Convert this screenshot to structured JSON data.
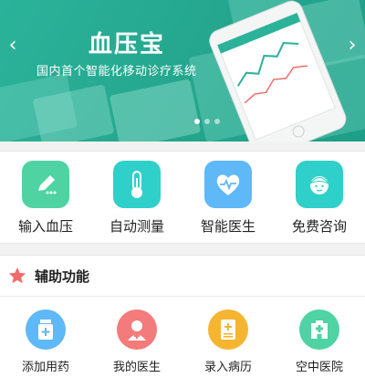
{
  "banner": {
    "title": "血压宝",
    "subtitle": "国内首个智能化移动诊疗系统",
    "prev_icon": "chevron-left-icon",
    "next_icon": "chevron-right-icon",
    "slide_count": 3,
    "active_slide": 1
  },
  "quick_actions": [
    {
      "label": "输入血压",
      "icon": "pencil-icon",
      "color": "#4fd3a3"
    },
    {
      "label": "自动测量",
      "icon": "thermometer-icon",
      "color": "#2fd0c9"
    },
    {
      "label": "智能医生",
      "icon": "heartbeat-icon",
      "color": "#5fb8f7"
    },
    {
      "label": "免费咨询",
      "icon": "nurse-icon",
      "color": "#2fd0c9"
    }
  ],
  "section": {
    "title": "辅助功能",
    "icon": "star-icon",
    "icon_color": "#f26b6b"
  },
  "tools": [
    {
      "label": "添加用药",
      "icon": "medicine-bottle-icon",
      "color": "#5fb8f7"
    },
    {
      "label": "我的医生",
      "icon": "doctor-icon",
      "color": "#f47b7b"
    },
    {
      "label": "录入病历",
      "icon": "medical-record-icon",
      "color": "#f5b531"
    },
    {
      "label": "空中医院",
      "icon": "hospital-icon",
      "color": "#4fd3a3"
    }
  ]
}
